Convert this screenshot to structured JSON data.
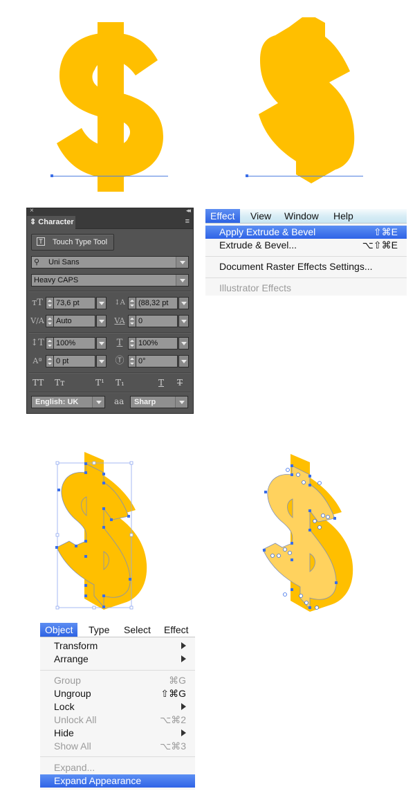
{
  "colors": {
    "gold": "#ffbf00",
    "light_gold": "#ffd25e",
    "selection_blue": "#4f7fe0",
    "menu_highlight": "#2f63e6"
  },
  "artwork": {
    "glyph_flat": "$",
    "glyph_extruded_preview": "$",
    "glyph_extruded_selected": "$",
    "glyph_expanded": "$"
  },
  "character_panel": {
    "close_icon": "×",
    "collapse_icon": "◂◂",
    "tab_label": "Character",
    "menu_icon": "≡",
    "touch_type_label": "Touch Type Tool",
    "font_family": "Uni Sans",
    "font_style": "Heavy CAPS",
    "font_size": "73,6 pt",
    "leading": "(88,32 pt",
    "kerning": "Auto",
    "tracking": "0",
    "vertical_scale": "100%",
    "horizontal_scale": "100%",
    "baseline_shift": "0 pt",
    "rotation": "0°",
    "type_buttons": [
      "TT",
      "Tт",
      "T¹",
      "T₁",
      "T",
      "T"
    ],
    "language": "English: UK",
    "antialias_icon": "aa",
    "antialias": "Sharp"
  },
  "effect_menu": {
    "menubar": [
      "Effect",
      "View",
      "Window",
      "Help"
    ],
    "items": [
      {
        "label": "Apply Extrude & Bevel",
        "shortcut": "⇧⌘E"
      },
      {
        "label": "Extrude & Bevel...",
        "shortcut": "⌥⇧⌘E"
      },
      {
        "label": "Document Raster Effects Settings...",
        "shortcut": ""
      },
      {
        "label": "Illustrator Effects",
        "shortcut": ""
      }
    ]
  },
  "object_menu": {
    "menubar": [
      "Object",
      "Type",
      "Select",
      "Effect"
    ],
    "items": [
      {
        "label": "Transform",
        "shortcut": ""
      },
      {
        "label": "Arrange",
        "shortcut": ""
      },
      {
        "label": "Group",
        "shortcut": "⌘G"
      },
      {
        "label": "Ungroup",
        "shortcut": "⇧⌘G"
      },
      {
        "label": "Lock",
        "shortcut": ""
      },
      {
        "label": "Unlock All",
        "shortcut": "⌥⌘2"
      },
      {
        "label": "Hide",
        "shortcut": ""
      },
      {
        "label": "Show All",
        "shortcut": "⌥⌘3"
      },
      {
        "label": "Expand...",
        "shortcut": ""
      },
      {
        "label": "Expand Appearance",
        "shortcut": ""
      }
    ]
  }
}
